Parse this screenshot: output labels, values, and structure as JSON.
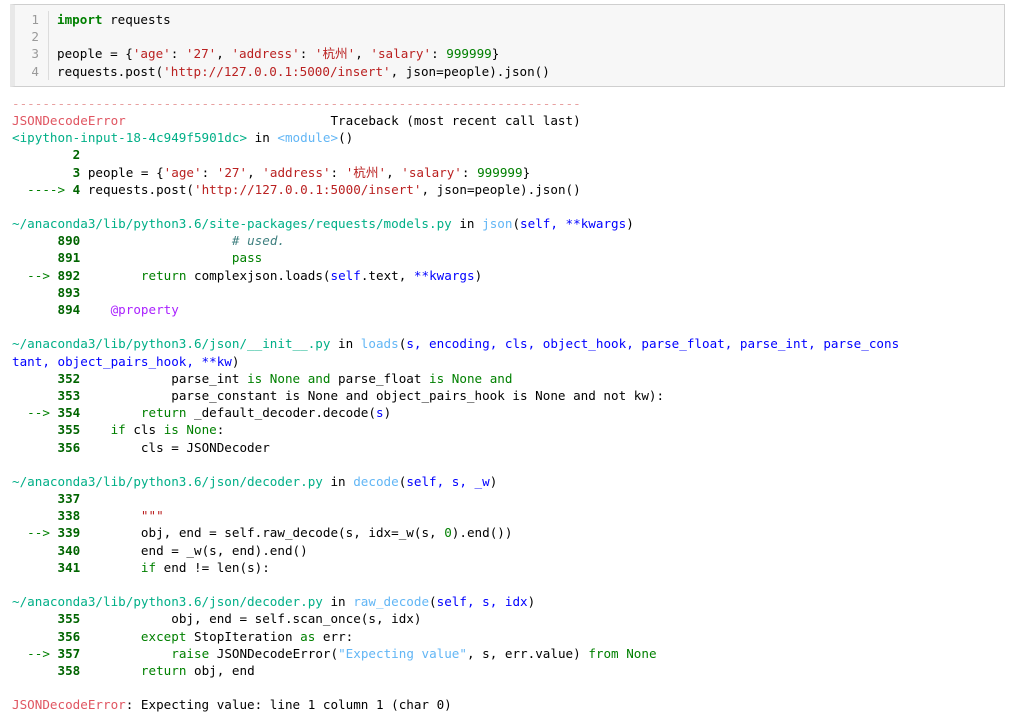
{
  "notebook": {
    "input_cell": {
      "lines": [
        {
          "n": "1",
          "tokens": [
            {
              "t": "import",
              "c": "kw"
            },
            {
              "t": " requests",
              "c": "plain"
            }
          ]
        },
        {
          "n": "2",
          "tokens": []
        },
        {
          "n": "3",
          "tokens": [
            {
              "t": "people = {",
              "c": "plain"
            },
            {
              "t": "'age'",
              "c": "str"
            },
            {
              "t": ": ",
              "c": "plain"
            },
            {
              "t": "'27'",
              "c": "str"
            },
            {
              "t": ", ",
              "c": "plain"
            },
            {
              "t": "'address'",
              "c": "str"
            },
            {
              "t": ": ",
              "c": "plain"
            },
            {
              "t": "'杭州'",
              "c": "str"
            },
            {
              "t": ", ",
              "c": "plain"
            },
            {
              "t": "'salary'",
              "c": "str"
            },
            {
              "t": ": ",
              "c": "plain"
            },
            {
              "t": "999999",
              "c": "num"
            },
            {
              "t": "}",
              "c": "plain"
            }
          ]
        },
        {
          "n": "4",
          "tokens": [
            {
              "t": "requests.post(",
              "c": "plain"
            },
            {
              "t": "'http://127.0.0.1:5000/insert'",
              "c": "str"
            },
            {
              "t": ", json=people).json()",
              "c": "plain"
            }
          ]
        }
      ],
      "raw_text": "import requests\n\npeople = {'age': '27', 'address': '杭州', 'salary': 999999}\nrequests.post('http://127.0.0.1:5000/insert', json=people).json()"
    },
    "traceback": {
      "separator": "---------------------------------------------------------------------------",
      "error_type": "JSONDecodeError",
      "header_right": "Traceback (most recent call last)",
      "final_error_type": "JSONDecodeError",
      "final_error_message": ": Expecting value: line 1 column 1 (char 0)",
      "frames": [
        {
          "location_parts": [
            {
              "t": "<ipython-input-18-4c949f5901dc>",
              "c": "fname"
            },
            {
              "t": " in ",
              "c": "plain"
            },
            {
              "t": "<module>",
              "c": "cyan"
            },
            {
              "t": "()",
              "c": "plain"
            }
          ],
          "lines": [
            {
              "arrow": "",
              "n": "2",
              "tokens": []
            },
            {
              "arrow": "",
              "n": "3",
              "tokens": [
                {
                  "t": " people = {",
                  "c": "plain"
                },
                {
                  "t": "'age'",
                  "c": "str"
                },
                {
                  "t": ": ",
                  "c": "plain"
                },
                {
                  "t": "'27'",
                  "c": "str"
                },
                {
                  "t": ", ",
                  "c": "plain"
                },
                {
                  "t": "'address'",
                  "c": "str"
                },
                {
                  "t": ": ",
                  "c": "plain"
                },
                {
                  "t": "'杭州'",
                  "c": "str"
                },
                {
                  "t": ", ",
                  "c": "plain"
                },
                {
                  "t": "'salary'",
                  "c": "str"
                },
                {
                  "t": ": ",
                  "c": "plain"
                },
                {
                  "t": "999999",
                  "c": "num"
                },
                {
                  "t": "}",
                  "c": "plain"
                }
              ]
            },
            {
              "arrow": "----> ",
              "n": "4",
              "tokens": [
                {
                  "t": " requests.post(",
                  "c": "plain"
                },
                {
                  "t": "'http://127.0.0.1:5000/insert'",
                  "c": "str"
                },
                {
                  "t": ", json=people).json()",
                  "c": "plain"
                }
              ]
            }
          ]
        },
        {
          "location_parts": [
            {
              "t": "~/anaconda3/lib/python3.6/site-packages/requests/models.py",
              "c": "fname"
            },
            {
              "t": " in ",
              "c": "plain"
            },
            {
              "t": "json",
              "c": "cyan"
            },
            {
              "t": "(",
              "c": "plain"
            },
            {
              "t": "self, **kwargs",
              "c": "blue"
            },
            {
              "t": ")",
              "c": "plain"
            }
          ],
          "lines": [
            {
              "arrow": "",
              "n": "890",
              "tokens": [
                {
                  "t": "                    ",
                  "c": "plain"
                },
                {
                  "t": "# used.",
                  "c": "cmt"
                }
              ]
            },
            {
              "arrow": "",
              "n": "891",
              "tokens": [
                {
                  "t": "                    ",
                  "c": "plain"
                },
                {
                  "t": "pass",
                  "c": "kw2"
                }
              ]
            },
            {
              "arrow": "--> ",
              "n": "892",
              "tokens": [
                {
                  "t": "        ",
                  "c": "plain"
                },
                {
                  "t": "return",
                  "c": "kw2"
                },
                {
                  "t": " complexjson.loads(",
                  "c": "plain"
                },
                {
                  "t": "self",
                  "c": "blue"
                },
                {
                  "t": ".text, ",
                  "c": "plain"
                },
                {
                  "t": "**kwargs",
                  "c": "blue"
                },
                {
                  "t": ")",
                  "c": "plain"
                }
              ]
            },
            {
              "arrow": "",
              "n": "893",
              "tokens": []
            },
            {
              "arrow": "",
              "n": "894",
              "tokens": [
                {
                  "t": "    ",
                  "c": "plain"
                },
                {
                  "t": "@property",
                  "c": "deco"
                }
              ]
            }
          ]
        },
        {
          "location_parts": [
            {
              "t": "~/anaconda3/lib/python3.6/json/__init__.py",
              "c": "fname"
            },
            {
              "t": " in ",
              "c": "plain"
            },
            {
              "t": "loads",
              "c": "cyan"
            },
            {
              "t": "(",
              "c": "plain"
            },
            {
              "t": "s, encoding, cls, object_hook, parse_float, parse_int, parse_cons",
              "c": "blue"
            }
          ],
          "location_wrap": [
            {
              "t": "tant, object_pairs_hook, **kw",
              "c": "blue"
            },
            {
              "t": ")",
              "c": "plain"
            }
          ],
          "lines": [
            {
              "arrow": "",
              "n": "352",
              "tokens": [
                {
                  "t": "            parse_int ",
                  "c": "plain"
                },
                {
                  "t": "is None and",
                  "c": "kw2"
                },
                {
                  "t": " parse_float ",
                  "c": "plain"
                },
                {
                  "t": "is None and",
                  "c": "kw2"
                }
              ]
            },
            {
              "arrow": "",
              "n": "353",
              "tokens": [
                {
                  "t": "            parse_constant is None and object_pairs_hook is None and not kw):",
                  "c": "plain"
                }
              ]
            },
            {
              "arrow": "--> ",
              "n": "354",
              "tokens": [
                {
                  "t": "        ",
                  "c": "plain"
                },
                {
                  "t": "return",
                  "c": "kw2"
                },
                {
                  "t": " _default_decoder.decode(",
                  "c": "plain"
                },
                {
                  "t": "s",
                  "c": "blue"
                },
                {
                  "t": ")",
                  "c": "plain"
                }
              ]
            },
            {
              "arrow": "",
              "n": "355",
              "tokens": [
                {
                  "t": "    ",
                  "c": "plain"
                },
                {
                  "t": "if",
                  "c": "kw2"
                },
                {
                  "t": " cls ",
                  "c": "plain"
                },
                {
                  "t": "is None",
                  "c": "kw2"
                },
                {
                  "t": ":",
                  "c": "plain"
                }
              ]
            },
            {
              "arrow": "",
              "n": "356",
              "tokens": [
                {
                  "t": "        cls = JSONDecoder",
                  "c": "plain"
                }
              ]
            }
          ]
        },
        {
          "location_parts": [
            {
              "t": "~/anaconda3/lib/python3.6/json/decoder.py",
              "c": "fname"
            },
            {
              "t": " in ",
              "c": "plain"
            },
            {
              "t": "decode",
              "c": "cyan"
            },
            {
              "t": "(",
              "c": "plain"
            },
            {
              "t": "self, s, _w",
              "c": "blue"
            },
            {
              "t": ")",
              "c": "plain"
            }
          ],
          "lines": [
            {
              "arrow": "",
              "n": "337",
              "tokens": []
            },
            {
              "arrow": "",
              "n": "338",
              "tokens": [
                {
                  "t": "        ",
                  "c": "plain"
                },
                {
                  "t": "\"\"\"",
                  "c": "str"
                }
              ]
            },
            {
              "arrow": "--> ",
              "n": "339",
              "tokens": [
                {
                  "t": "        obj, end = self.raw_decode(s, idx=_w(s, ",
                  "c": "plain"
                },
                {
                  "t": "0",
                  "c": "num"
                },
                {
                  "t": ").end())",
                  "c": "plain"
                }
              ]
            },
            {
              "arrow": "",
              "n": "340",
              "tokens": [
                {
                  "t": "        end = _w(s, end).end()",
                  "c": "plain"
                }
              ]
            },
            {
              "arrow": "",
              "n": "341",
              "tokens": [
                {
                  "t": "        ",
                  "c": "plain"
                },
                {
                  "t": "if",
                  "c": "kw2"
                },
                {
                  "t": " end != len(s):",
                  "c": "plain"
                }
              ]
            }
          ]
        },
        {
          "location_parts": [
            {
              "t": "~/anaconda3/lib/python3.6/json/decoder.py",
              "c": "fname"
            },
            {
              "t": " in ",
              "c": "plain"
            },
            {
              "t": "raw_decode",
              "c": "cyan"
            },
            {
              "t": "(",
              "c": "plain"
            },
            {
              "t": "self, s, idx",
              "c": "blue"
            },
            {
              "t": ")",
              "c": "plain"
            }
          ],
          "lines": [
            {
              "arrow": "",
              "n": "355",
              "tokens": [
                {
                  "t": "            obj, end = self.scan_once(s, idx)",
                  "c": "plain"
                }
              ]
            },
            {
              "arrow": "",
              "n": "356",
              "tokens": [
                {
                  "t": "        ",
                  "c": "plain"
                },
                {
                  "t": "except",
                  "c": "kw2"
                },
                {
                  "t": " StopIteration ",
                  "c": "plain"
                },
                {
                  "t": "as",
                  "c": "kw2"
                },
                {
                  "t": " err:",
                  "c": "plain"
                }
              ]
            },
            {
              "arrow": "--> ",
              "n": "357",
              "tokens": [
                {
                  "t": "            ",
                  "c": "plain"
                },
                {
                  "t": "raise",
                  "c": "kw2"
                },
                {
                  "t": " JSONDecodeError(",
                  "c": "plain"
                },
                {
                  "t": "\"Expecting value\"",
                  "c": "strb"
                },
                {
                  "t": ", s, err.value) ",
                  "c": "plain"
                },
                {
                  "t": "from None",
                  "c": "kw2"
                }
              ]
            },
            {
              "arrow": "",
              "n": "358",
              "tokens": [
                {
                  "t": "        ",
                  "c": "plain"
                },
                {
                  "t": "return",
                  "c": "kw2"
                },
                {
                  "t": " obj, end",
                  "c": "plain"
                }
              ]
            }
          ]
        }
      ]
    }
  },
  "colors": {
    "error_red": "#e05561",
    "separator_red": "#e8a0a0",
    "string_red": "#ba2121",
    "keyword_green": "#008000",
    "filepath_green": "#00af87",
    "funcname_cyan": "#62b6f5",
    "arg_blue": "#0000ff",
    "linenum_green": "#006400",
    "comment_teal": "#408080",
    "decorator_purple": "#aa22ff",
    "cell_background": "#f7f7f7",
    "cell_border": "#cfcfcf"
  }
}
